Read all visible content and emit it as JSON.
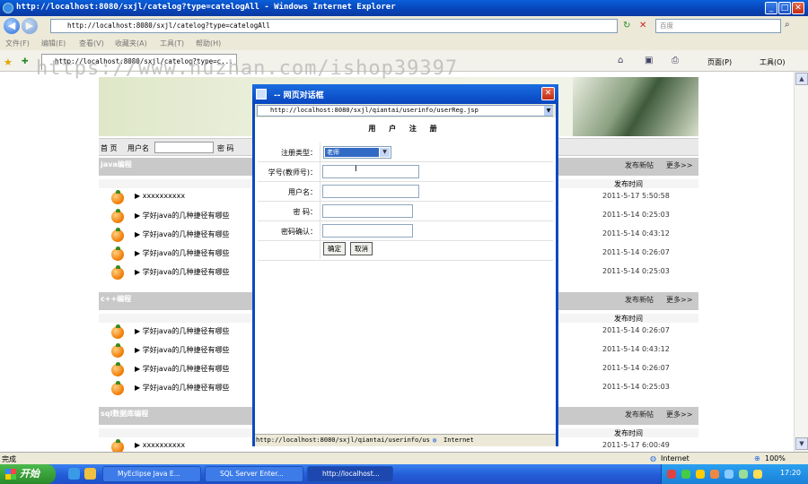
{
  "window": {
    "title": "http://localhost:8080/sxjl/catelog?type=catelogAll - Windows Internet Explorer",
    "minimize": "_",
    "maximize": "□",
    "close": "✕"
  },
  "address_bar": {
    "back": "◀",
    "forward": "▶",
    "url": "http://localhost:8080/sxjl/catelog?type=catelogAll",
    "refresh": "↻",
    "stop": "✕",
    "search_placeholder": "百度"
  },
  "menu": [
    "文件(F)",
    "编辑(E)",
    "查看(V)",
    "收藏夹(A)",
    "工具(T)",
    "帮助(H)"
  ],
  "tab": {
    "label": "http://localhost:8080/sxjl/catelog?type=c..."
  },
  "toolbar_right": {
    "page": "页面(P)",
    "tools": "工具(O)"
  },
  "watermark": "https://www.huzhan.com/ishop39397",
  "login_bar": {
    "home": "首 页",
    "username": "用户名",
    "password": "密 码"
  },
  "sections": [
    {
      "name": "java编程",
      "post": "发布新帖",
      "more": "更多>>",
      "time_header": "发布时间",
      "rows": [
        {
          "title": "xxxxxxxxxx",
          "date": "2011-5-17 5:50:58"
        },
        {
          "title": "学好java的几种捷径有哪些",
          "date": "2011-5-14 0:25:03"
        },
        {
          "title": "学好java的几种捷径有哪些",
          "date": "2011-5-14 0:43:12"
        },
        {
          "title": "学好java的几种捷径有哪些",
          "date": "2011-5-14 0:26:07"
        },
        {
          "title": "学好java的几种捷径有哪些",
          "date": "2011-5-14 0:25:03"
        }
      ]
    },
    {
      "name": "c++编程",
      "post": "发布新帖",
      "more": "更多>>",
      "time_header": "发布时间",
      "rows": [
        {
          "title": "学好java的几种捷径有哪些",
          "date": "2011-5-14 0:26:07"
        },
        {
          "title": "学好java的几种捷径有哪些",
          "date": "2011-5-14 0:43:12"
        },
        {
          "title": "学好java的几种捷径有哪些",
          "date": "2011-5-14 0:26:07"
        },
        {
          "title": "学好java的几种捷径有哪些",
          "date": "2011-5-14 0:25:03"
        }
      ]
    },
    {
      "name": "sql数据库编程",
      "post": "发布新帖",
      "more": "更多>>",
      "time_header": "发布时间",
      "rows": [
        {
          "title": "xxxxxxxxxx",
          "date": "2011-5-17 6:00:49"
        }
      ]
    }
  ],
  "dialog": {
    "title": "-- 网页对话框",
    "url": "http://localhost:8080/sxjl/qiantai/userinfo/userReg.jsp",
    "heading": "用 户 注 册",
    "fields": [
      {
        "label": "注册类型：",
        "value": "老师"
      },
      {
        "label": "学号(教师号)：",
        "value": ""
      },
      {
        "label": "用户名：",
        "value": ""
      },
      {
        "label": "密 码：",
        "value": ""
      },
      {
        "label": "密码确认：",
        "value": ""
      }
    ],
    "ok": "确定",
    "cancel": "取消",
    "status_url": "http://localhost:8080/sxjl/qiantai/userinfo/us",
    "status_zone": "Internet"
  },
  "status_bar": {
    "text": "完成",
    "zone": "Internet",
    "zoom": "100%"
  },
  "taskbar": {
    "start": "开始",
    "tasks": [
      "MyEclipse Java E...",
      "SQL Server Enter...",
      "http://localhost..."
    ],
    "clock": "17:20"
  }
}
